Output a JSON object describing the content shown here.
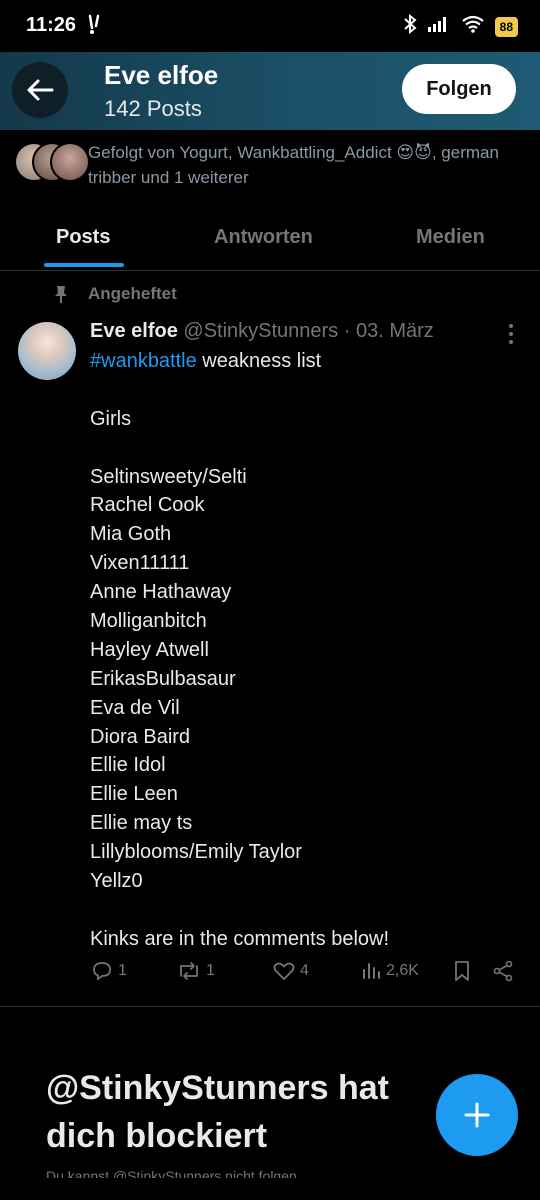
{
  "status_bar": {
    "time": "11:26",
    "battery": "88"
  },
  "header": {
    "name": "Eve elfoe",
    "posts": "142 Posts",
    "follow_label": "Folgen"
  },
  "followed_by": {
    "text": "Gefolgt von Yogurt, Wankbattling_Addict 😍😈, german tribber und 1 weiterer"
  },
  "tabs": [
    {
      "label": "Posts",
      "active": true
    },
    {
      "label": "Antworten",
      "active": false
    },
    {
      "label": "Medien",
      "active": false
    }
  ],
  "pinned_label": "Angeheftet",
  "post": {
    "author": "Eve elfoe",
    "handle_date": "@StinkyStunners · 03. März",
    "hashtag": "#wankbattle",
    "first_line_rest": " weakness list",
    "lines": [
      "",
      "Girls",
      "",
      "Seltinsweety/Selti",
      "Rachel Cook",
      "Mia Goth",
      "Vixen11111",
      "Anne Hathaway",
      "Molliganbitch",
      "Hayley Atwell",
      "ErikasBulbasaur",
      "Eva de Vil",
      "Diora Baird",
      "Ellie Idol",
      "Ellie Leen",
      "Ellie may ts",
      "Lillyblooms/Emily Taylor",
      "Yellz0",
      "",
      "Kinks are in the comments below!"
    ],
    "replies": "1",
    "reposts": "1",
    "likes": "4",
    "views": "2,6K"
  },
  "blocked": {
    "title": "@StinkyStunners hat dich blockiert",
    "sub": "Du kannst @StinkyStunners nicht folgen"
  },
  "colors": {
    "accent": "#1d9bf0",
    "header_bg": "#1b5067",
    "background": "#000000"
  }
}
